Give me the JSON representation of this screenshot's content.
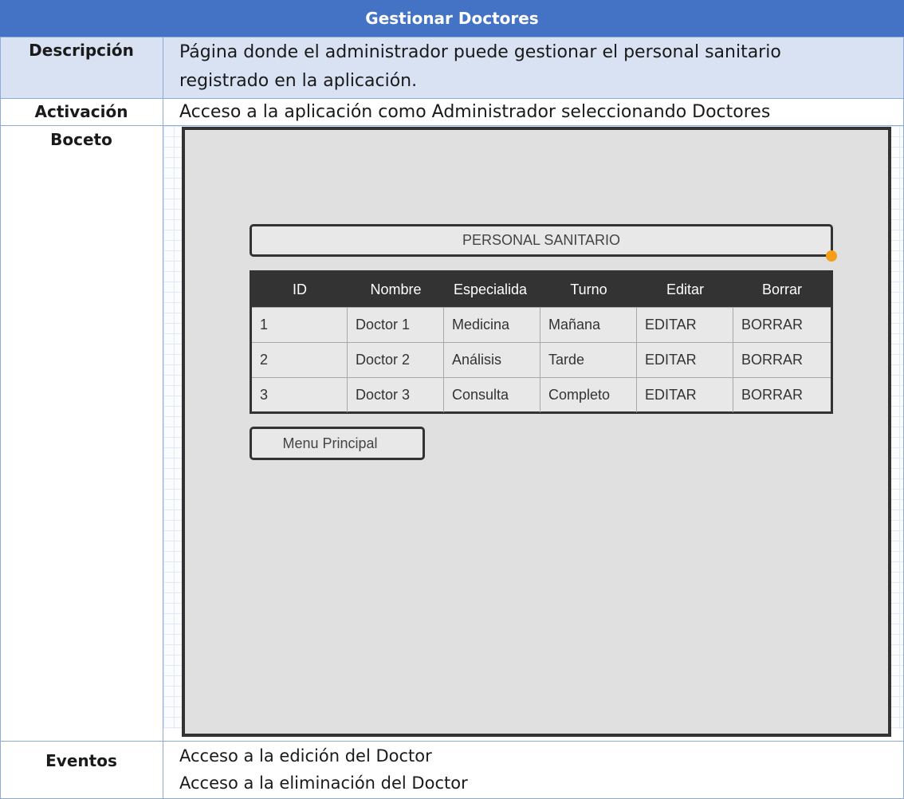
{
  "title": "Gestionar Doctores",
  "rows": {
    "descripcion": {
      "label": "Descripción",
      "line1": "Página donde el administrador puede gestionar el personal sanitario",
      "line2": "registrado en la aplicación."
    },
    "activacion": {
      "label": "Activación",
      "text": "Acceso a la aplicación como Administrador seleccionando Doctores"
    },
    "boceto": {
      "label": "Boceto"
    },
    "eventos": {
      "label": "Eventos",
      "line1": "Acceso a la edición del Doctor",
      "line2": "Acceso a la eliminación del Doctor"
    }
  },
  "mockup": {
    "heading": "PERSONAL SANITARIO",
    "columns": [
      "ID",
      "Nombre",
      "Especialida",
      "Turno",
      "Editar",
      "Borrar"
    ],
    "table_rows": [
      [
        "1",
        "Doctor 1",
        "Medicina",
        "Mañana",
        "EDITAR",
        "BORRAR"
      ],
      [
        "2",
        "Doctor 2",
        "Análisis",
        "Tarde",
        "EDITAR",
        "BORRAR"
      ],
      [
        "3",
        "Doctor 3",
        "Consulta",
        "Completo",
        "EDITAR",
        "BORRAR"
      ]
    ],
    "menu_button": "Menu Principal"
  },
  "colors": {
    "header_blue": "#4472c4",
    "row_tint": "#d9e2f3",
    "border_blue": "#8eaadb",
    "handle_orange": "#f59c1a"
  }
}
